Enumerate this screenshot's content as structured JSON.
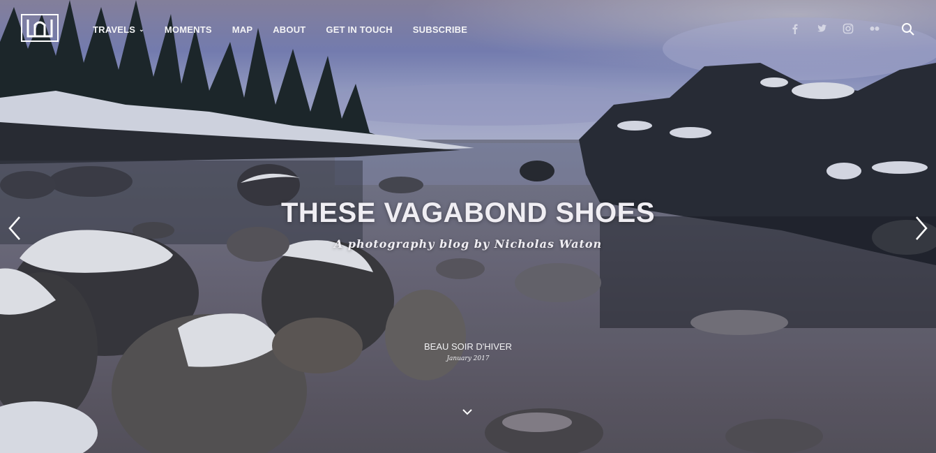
{
  "nav": {
    "items": [
      {
        "label": "TRAVELS",
        "has_dropdown": true
      },
      {
        "label": "MOMENTS"
      },
      {
        "label": "MAP"
      },
      {
        "label": "ABOUT"
      },
      {
        "label": "GET IN TOUCH"
      },
      {
        "label": "SUBSCRIBE"
      }
    ],
    "social_icons": [
      "facebook-icon",
      "twitter-icon",
      "instagram-icon",
      "flickr-icon"
    ],
    "search_icon": "search-icon"
  },
  "hero": {
    "title": "THESE VAGABOND SHOES",
    "subtitle": "A photography blog by Nicholas Waton",
    "slide_caption": "BEAU SOIR D'HIVER",
    "slide_date": "January 2017"
  },
  "colors": {
    "text": "#f0eef3",
    "sky": "#8a93c9",
    "water": "#6b6f86"
  }
}
